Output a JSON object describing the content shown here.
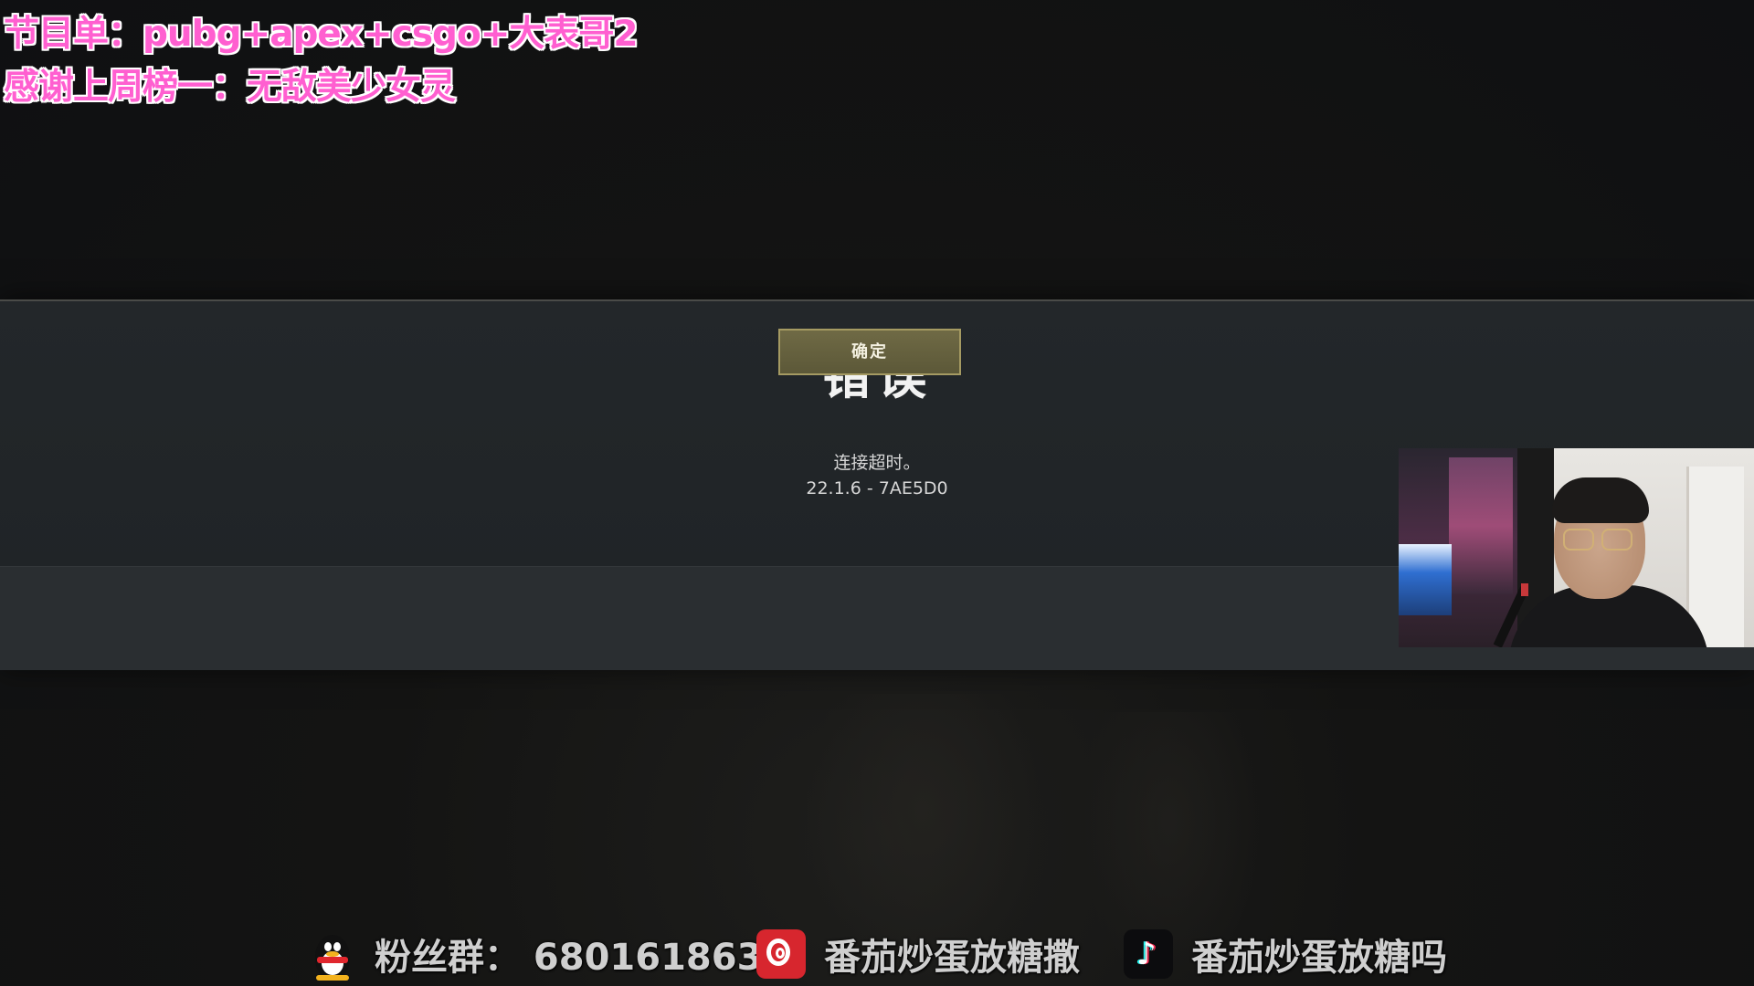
{
  "overlay": {
    "line1": "节目单：pubg+apex+csgo+大表哥2",
    "line2": "感谢上周榜一：无敌美少女灵"
  },
  "dialog": {
    "title": "错误",
    "message_line1": "连接超时。",
    "message_line2": "22.1.6 - 7AE5D0",
    "ok_label": "确定"
  },
  "bottom_bar": {
    "fan_group": "粉丝群：  680161863",
    "netease_name": "番茄炒蛋放糖撒",
    "douyin_name": "番茄炒蛋放糖吗",
    "icons": [
      "qq-penguin-icon",
      "netease-music-icon",
      "douyin-icon"
    ]
  },
  "colors": {
    "overlay_text": "#ff5fd0",
    "button_bg": "#6f6a45",
    "button_border": "#a59a62",
    "dialog_bg": "#23272a"
  }
}
